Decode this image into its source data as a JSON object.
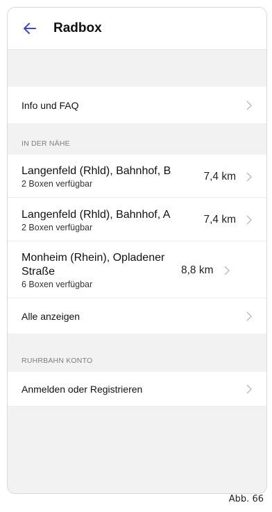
{
  "header": {
    "title": "Radbox"
  },
  "info_row": {
    "label": "Info und FAQ"
  },
  "nearby": {
    "section_label": "IN DER NÄHE",
    "stations": [
      {
        "name": "Langenfeld (Rhld), Bahnhof, B",
        "availability": "2 Boxen verfügbar",
        "distance": "7,4 km"
      },
      {
        "name": "Langenfeld (Rhld), Bahnhof, A",
        "availability": "2 Boxen verfügbar",
        "distance": "7,4 km"
      },
      {
        "name": "Monheim (Rhein), Opladener Straße",
        "availability": "6 Boxen verfügbar",
        "distance": "8,8 km"
      }
    ],
    "show_all_label": "Alle anzeigen"
  },
  "account": {
    "section_label": "RUHRBAHN KONTO",
    "login_label": "Anmelden oder Registrieren"
  },
  "caption": "Abb. 66",
  "colors": {
    "accent": "#3b46c8",
    "chevron": "#bdbdbd"
  }
}
